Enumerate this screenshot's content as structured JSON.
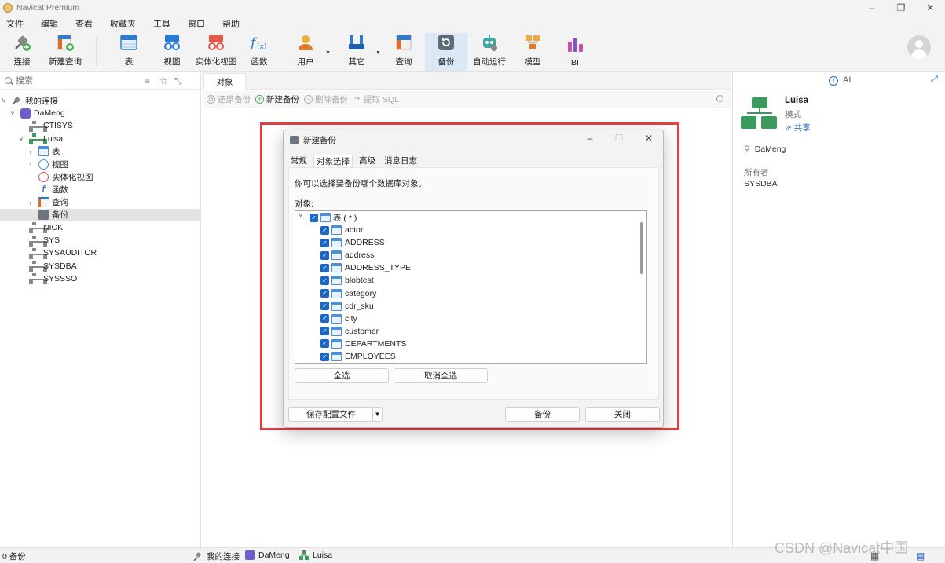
{
  "window": {
    "title": "Navicat Premium",
    "controls": [
      "–",
      "❐",
      "✕"
    ]
  },
  "menu": [
    "文件",
    "编辑",
    "查看",
    "收藏夹",
    "工具",
    "窗口",
    "帮助"
  ],
  "toolbar": {
    "connect": "连接",
    "new_query": "新建查询",
    "table": "表",
    "view": "视图",
    "materialized_view": "实体化视图",
    "function": "函数",
    "user": "用户",
    "other": "其它",
    "query": "查询",
    "backup": "备份",
    "automation": "自动运行",
    "model": "模型",
    "bi": "BI"
  },
  "left": {
    "search_placeholder": "搜索",
    "tree": {
      "my_connections": "我的连接",
      "dameng": "DaMeng",
      "ctisys": "CTISYS",
      "luisa": "Luisa",
      "tables": "表",
      "views": "视图",
      "mviews": "实体化视图",
      "functions": "函数",
      "queries": "查询",
      "backups": "备份",
      "nick": "NICK",
      "sys": "SYS",
      "sysauditor": "SYSAUDITOR",
      "sysdba": "SYSDBA",
      "syssso": "SYSSSO"
    }
  },
  "center": {
    "tab": "对象",
    "toolbar": {
      "restore": "还原备份",
      "new": "新建备份",
      "delete": "删除备份",
      "extract": "提取 SQL"
    }
  },
  "dialog": {
    "title": "新建备份",
    "tabs": [
      "常规",
      "对象选择",
      "高级",
      "消息日志"
    ],
    "hint": "你可以选择要备份哪个数据库对象。",
    "objects_label": "对象:",
    "root_label": "表 ( * )",
    "objects": [
      "actor",
      "ADDRESS",
      "address",
      "ADDRESS_TYPE",
      "blobtest",
      "category",
      "cdr_sku",
      "city",
      "customer",
      "DEPARTMENTS",
      "EMPLOYEES"
    ],
    "select_all": "全选",
    "deselect_all": "取消全选",
    "save_profile": "保存配置文件",
    "backup": "备份",
    "close": "关闭"
  },
  "right": {
    "ai_label": "AI",
    "name": "Luisa",
    "type": "模式",
    "share": "共享",
    "connection": "DaMeng",
    "owner_label": "所有者",
    "owner": "SYSDBA"
  },
  "status": {
    "count": "0 备份",
    "crumb1": "我的连接",
    "crumb2": "DaMeng",
    "crumb3": "Luisa"
  },
  "watermark": "CSDN @Navicat中国",
  "colors": {
    "accent": "#1e66c5",
    "highlight": "#e24040",
    "schema_green": "#3a9b5c",
    "dameng_purple": "#6d5bd0"
  }
}
